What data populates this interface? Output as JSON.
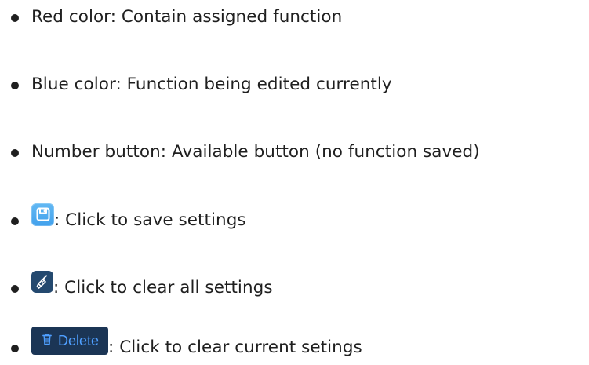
{
  "legend": {
    "items": [
      {
        "text": "Red color: Contain assigned function"
      },
      {
        "text": "Blue color: Function being edited currently"
      },
      {
        "text": "Number button: Available button (no function saved)"
      },
      {
        "icon": "save-icon",
        "text": ": Click to save settings"
      },
      {
        "icon": "broom-icon",
        "text": ": Click to clear all settings"
      },
      {
        "button_label": "Delete",
        "icon": "trash-icon",
        "text": ": Click to clear current setings"
      }
    ]
  },
  "colors": {
    "save_button": "#4ea9ef",
    "clear_button": "#24496f",
    "delete_button": "#1b3555",
    "delete_text": "#4f9fff",
    "bullet": "#1f1f1f"
  }
}
